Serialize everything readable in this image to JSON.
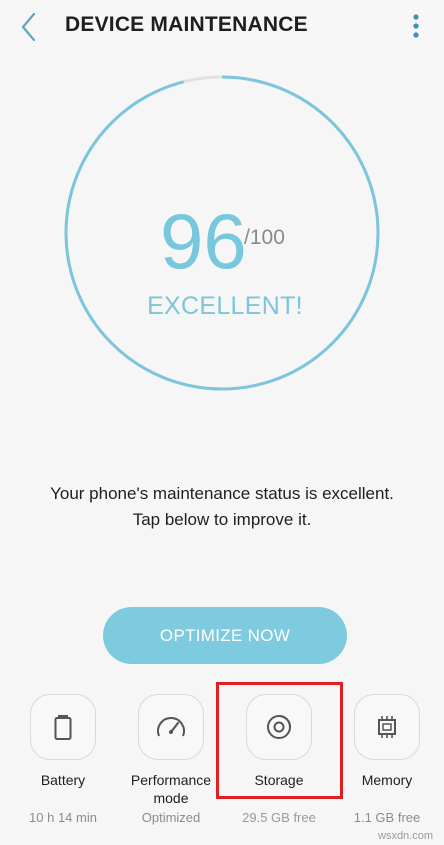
{
  "header": {
    "title": "DEVICE MAINTENANCE"
  },
  "score": {
    "value": "96",
    "max": "/100",
    "status": "EXCELLENT!",
    "fill_fraction": 0.96
  },
  "message": {
    "line1": "Your phone's maintenance status is excellent.",
    "line2": "Tap below to improve it."
  },
  "optimize": {
    "label": "OPTIMIZE NOW"
  },
  "items": [
    {
      "label": "Battery",
      "sub": "10 h 14 min",
      "icon": "battery-icon"
    },
    {
      "label": "Performance mode",
      "sub": "Optimized",
      "icon": "speedometer-icon"
    },
    {
      "label": "Storage",
      "sub": "29.5 GB free",
      "icon": "storage-disc-icon"
    },
    {
      "label": "Memory",
      "sub": "1.1 GB free",
      "icon": "memory-chip-icon"
    }
  ],
  "watermark": "wsxdn.com",
  "colors": {
    "accent": "#7ecbe0",
    "ring": "#7cc5dc",
    "ring_track": "#e2e2e2",
    "highlight": "#e02020"
  }
}
